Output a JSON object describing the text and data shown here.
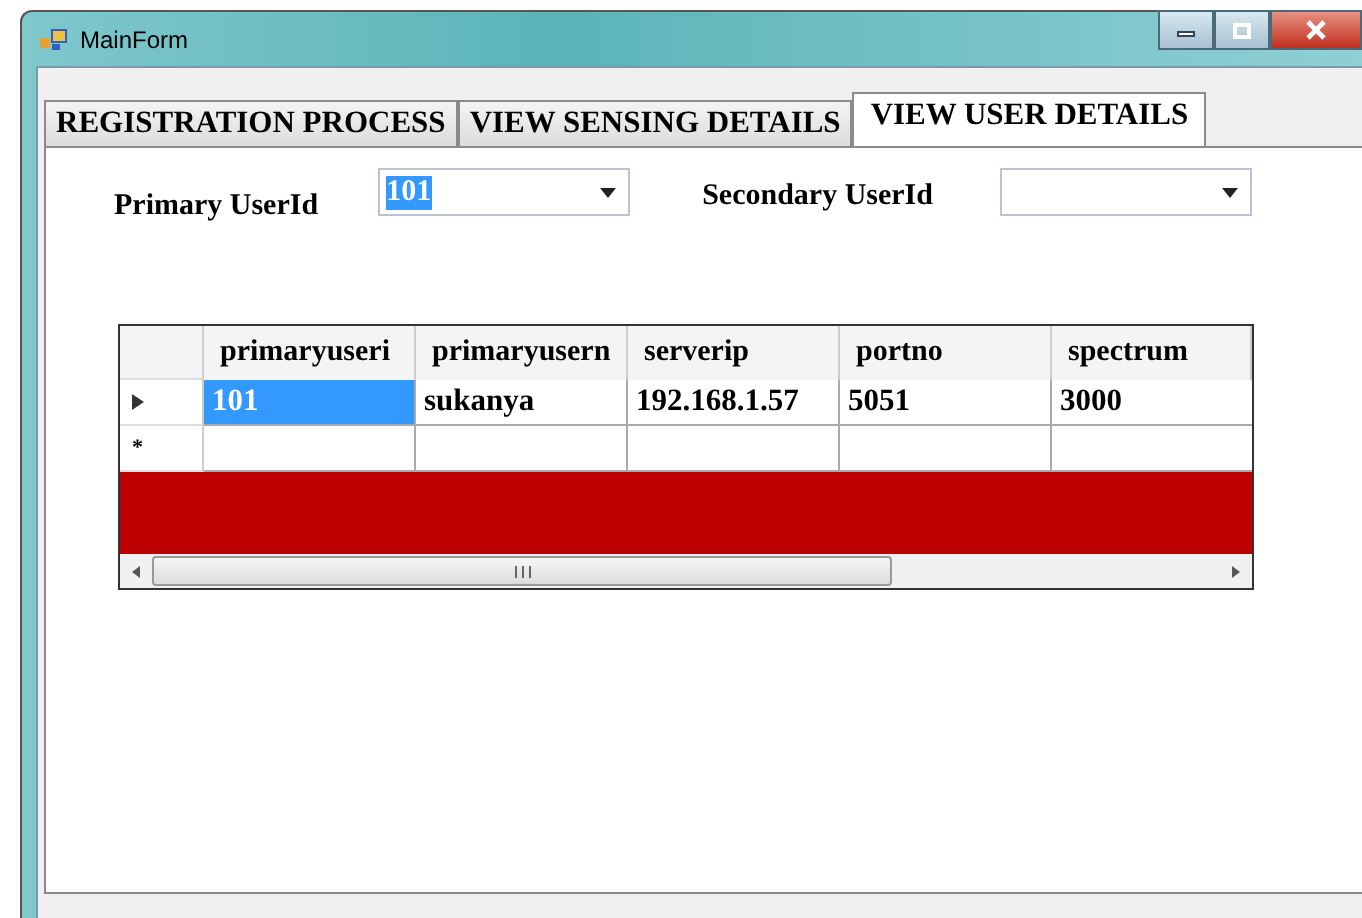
{
  "window": {
    "title": "MainForm"
  },
  "tabs": [
    {
      "label": "REGISTRATION PROCESS",
      "selected": false
    },
    {
      "label": "VIEW SENSING DETAILS",
      "selected": false
    },
    {
      "label": "VIEW USER DETAILS",
      "selected": true
    }
  ],
  "filters": [
    {
      "label": "Primary UserId",
      "value": "101",
      "value_selected": true
    },
    {
      "label": "Secondary UserId"
    }
  ],
  "grid": {
    "columns": [
      "primaryuseri",
      "primaryusern",
      "serverip",
      "portno",
      "spectrum"
    ],
    "rows": [
      {
        "kind": "current",
        "cells": [
          {
            "text": "101",
            "selected": true
          },
          {
            "text": "sukanya",
            "selected": false
          },
          {
            "text": "192.168.1.57",
            "selected": false
          },
          {
            "text": "5051",
            "selected": false
          },
          {
            "text": "3000",
            "selected": false
          }
        ]
      },
      {
        "kind": "new",
        "marker": "*",
        "cells": [
          {
            "selected": false
          },
          {
            "selected": false
          },
          {
            "selected": false
          },
          {
            "selected": false
          },
          {
            "selected": false
          }
        ]
      }
    ]
  }
}
